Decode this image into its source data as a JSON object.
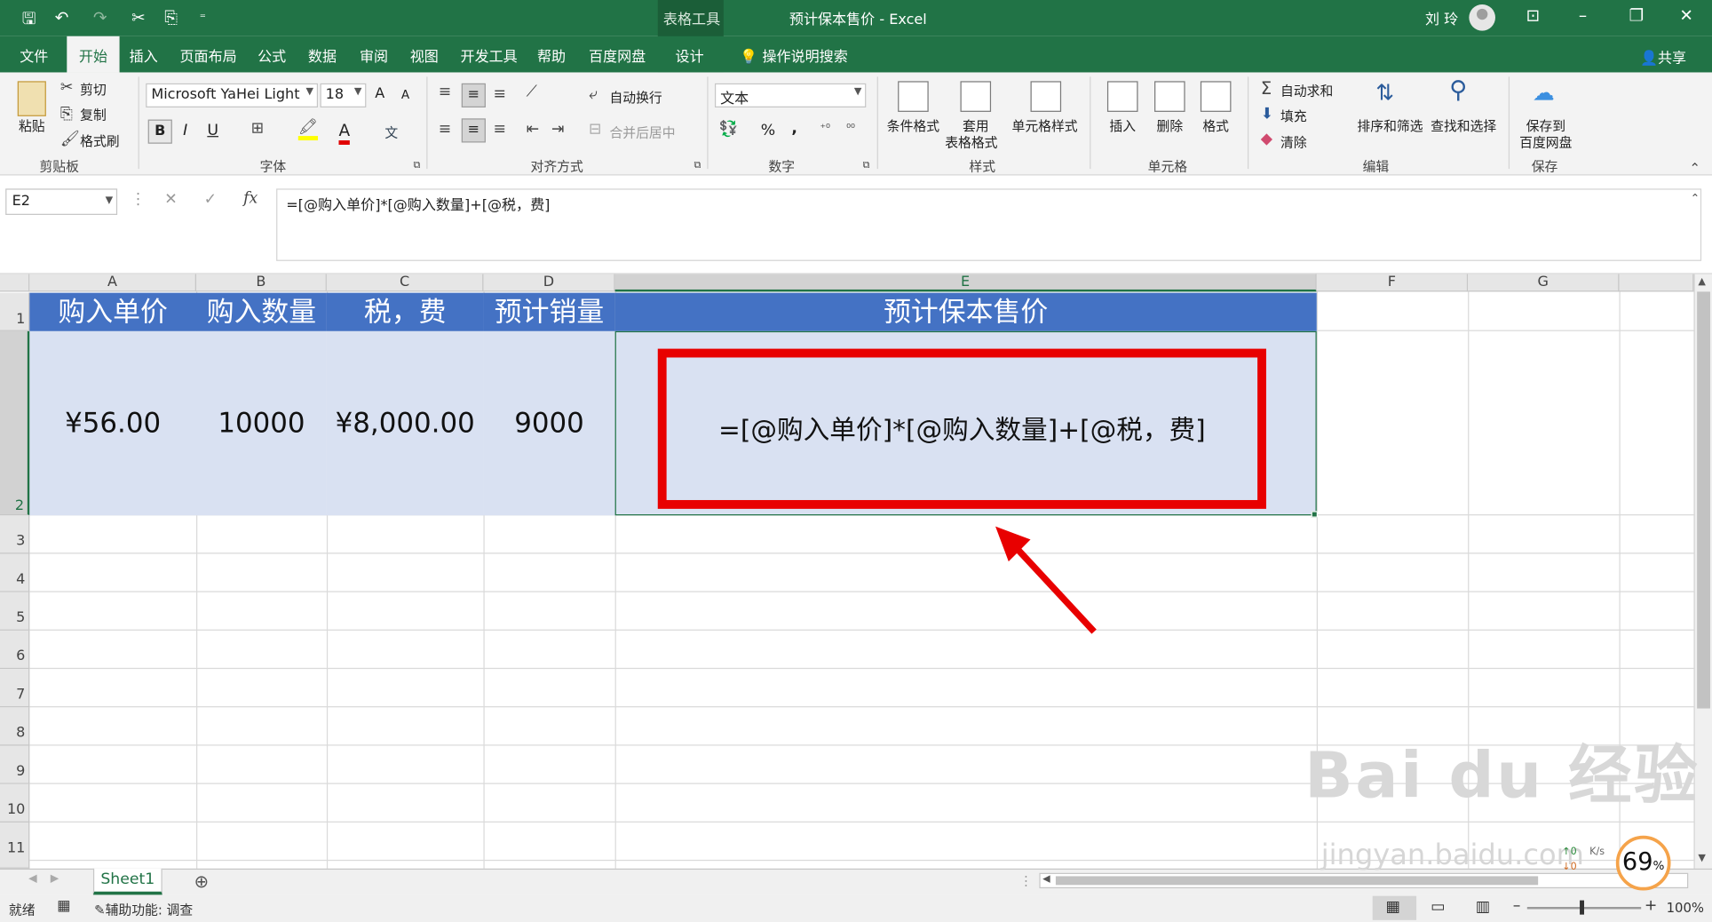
{
  "titlebar": {
    "context_tab": "表格工具",
    "title": "预计保本售价 - Excel",
    "user": "刘 玲",
    "qa_more": "⁼"
  },
  "tabs": [
    "文件",
    "开始",
    "插入",
    "页面布局",
    "公式",
    "数据",
    "审阅",
    "视图",
    "开发工具",
    "帮助",
    "百度网盘",
    "设计"
  ],
  "tell_me": "操作说明搜索",
  "share": "共享",
  "ribbon": {
    "clipboard": {
      "paste": "粘贴",
      "cut": "剪切",
      "copy": "复制",
      "format_painter": "格式刷",
      "label": "剪贴板"
    },
    "font": {
      "name": "Microsoft YaHei Light",
      "size": "18",
      "label": "字体",
      "bold": "B",
      "italic": "I",
      "underline": "U",
      "grow": "A",
      "shrink": "A",
      "wen": "文"
    },
    "alignment": {
      "wrap": "自动换行",
      "merge": "合并后居中",
      "label": "对齐方式"
    },
    "number": {
      "format": "文本",
      "label": "数字",
      "percent": "%",
      "comma": ","
    },
    "styles": {
      "conditional": "条件格式",
      "table": "套用",
      "table2": "表格格式",
      "cell": "单元格样式",
      "label": "样式"
    },
    "cells": {
      "insert": "插入",
      "delete": "删除",
      "format": "格式",
      "label": "单元格"
    },
    "editing": {
      "autosum": "自动求和",
      "fill": "填充",
      "clear": "清除",
      "sort": "排序和筛选",
      "find": "查找和选择",
      "label": "编辑"
    },
    "save": {
      "line1": "保存到",
      "line2": "百度网盘",
      "label": "保存"
    }
  },
  "namebox": "E2",
  "formula": "=[@购入单价]*[@购入数量]+[@税，费]",
  "columns": [
    "A",
    "B",
    "C",
    "D",
    "E",
    "F",
    "G"
  ],
  "rows": [
    "1",
    "2",
    "3",
    "4",
    "5",
    "6",
    "7",
    "8",
    "9",
    "10",
    "11"
  ],
  "headers": [
    "购入单价",
    "购入数量",
    "税，费",
    "预计销量",
    "预计保本售价"
  ],
  "values": [
    "¥56.00",
    "10000",
    "¥8,000.00",
    "9000"
  ],
  "e2_formula": "=[@购入单价]*[@购入数量]+[@税，费]",
  "sheet": "Sheet1",
  "status": {
    "ready": "就绪",
    "access": "辅助功能: 调查",
    "zoom": "100%"
  },
  "watermark": {
    "brand": "Bai du 经验",
    "url": "jingyan.baidu.com"
  },
  "perf": {
    "value": "69",
    "unit": "%",
    "speed_up": "0",
    "speed_unit": "K/s",
    "speed_down": "0"
  }
}
